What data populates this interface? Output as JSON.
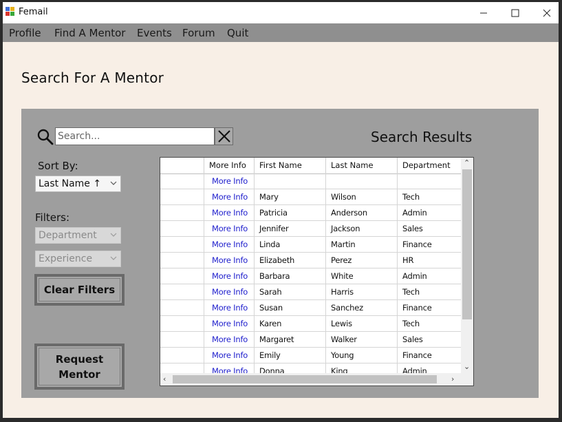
{
  "window": {
    "title": "Femail"
  },
  "menu": [
    "Profile",
    "Find A Mentor",
    "Events",
    "Forum",
    "Quit"
  ],
  "page_title": "Search For A Mentor",
  "search": {
    "placeholder": "Search..."
  },
  "results_title": "Search Results",
  "sort": {
    "label": "Sort By:",
    "value": "Last Name ↑"
  },
  "filters": {
    "label": "Filters:",
    "department": "Department",
    "experience": "Experience"
  },
  "buttons": {
    "clear_filters": "Clear Filters",
    "request_line1": "Request",
    "request_line2": "Mentor"
  },
  "table": {
    "columns": [
      "",
      "More Info",
      "First Name",
      "Last Name",
      "Department"
    ],
    "rows": [
      [
        "",
        "More Info",
        "",
        "",
        ""
      ],
      [
        "",
        "More Info",
        "Mary",
        "Wilson",
        "Tech"
      ],
      [
        "",
        "More Info",
        "Patricia",
        "Anderson",
        "Admin"
      ],
      [
        "",
        "More Info",
        "Jennifer",
        "Jackson",
        "Sales"
      ],
      [
        "",
        "More Info",
        "Linda",
        "Martin",
        "Finance"
      ],
      [
        "",
        "More Info",
        "Elizabeth",
        "Perez",
        "HR"
      ],
      [
        "",
        "More Info",
        "Barbara",
        "White",
        "Admin"
      ],
      [
        "",
        "More Info",
        "Sarah",
        "Harris",
        "Tech"
      ],
      [
        "",
        "More Info",
        "Susan",
        "Sanchez",
        "Finance"
      ],
      [
        "",
        "More Info",
        "Karen",
        "Lewis",
        "Tech"
      ],
      [
        "",
        "More Info",
        "Margaret",
        "Walker",
        "Sales"
      ],
      [
        "",
        "More Info",
        "Emily",
        "Young",
        "Finance"
      ],
      [
        "",
        "More Info",
        "Donna",
        "King",
        "Admin"
      ]
    ]
  },
  "colors": {
    "panel": "#9e9e9e",
    "menubar": "#8f8f8f",
    "background": "#f8efe6",
    "link": "#1c1ccc"
  },
  "icons": {
    "search": "magnifier-icon",
    "clear": "x-icon"
  }
}
